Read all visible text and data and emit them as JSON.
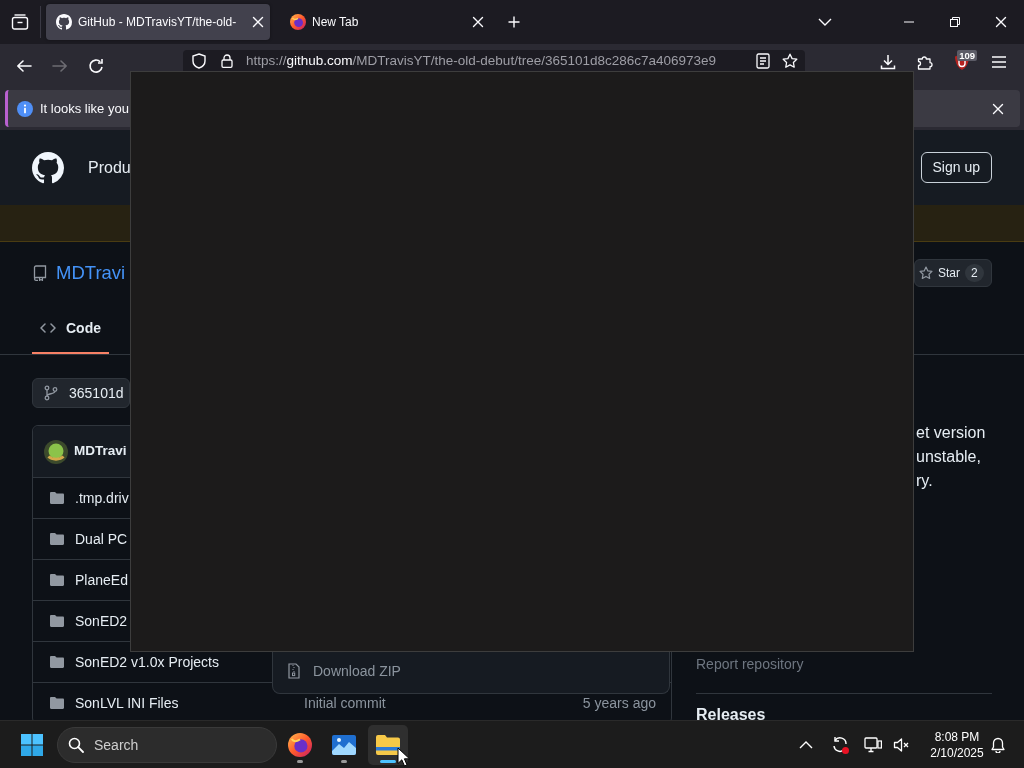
{
  "browser": {
    "tabs": [
      {
        "kind": "site",
        "title": "GitHub - MDTravisYT/the-old-",
        "selected": true
      },
      {
        "kind": "newtab",
        "title": "New Tab",
        "selected": false
      }
    ],
    "toolbar": {
      "back_disabled": false,
      "forward_disabled": true,
      "url_scheme": "https://",
      "url_host": "github.com",
      "url_path": "/MDTravisYT/the-old-debut/tree/365101d8c286c7a406973e9",
      "extension_badge": "109"
    },
    "notification": {
      "text": "It looks like you"
    }
  },
  "github": {
    "header": {
      "nav_item": "Produ",
      "sign_up": "Sign up"
    },
    "repo": {
      "owner": "MDTravi",
      "star_label": "Star",
      "star_count": "2"
    },
    "tabs": [
      {
        "label": "Code",
        "selected": true
      }
    ],
    "branch": "365101d",
    "commit_author": "MDTravi",
    "files": [
      {
        "name": ".tmp.driv"
      },
      {
        "name": "Dual PC"
      },
      {
        "name": "PlaneEd"
      },
      {
        "name": "SonED2"
      },
      {
        "name": "SonED2 v1.0x Projects"
      },
      {
        "name": "SonLVL INI Files",
        "message": "Initial commit",
        "age": "5 years ago"
      }
    ],
    "code_menu": [
      "Download ZIP"
    ],
    "about_lines": [
      "et version",
      "unstable,",
      "ry."
    ],
    "report_link": "Report repository",
    "releases_heading": "Releases"
  },
  "taskbar": {
    "search_placeholder": "Search",
    "apps": [
      {
        "kind": "browser",
        "selected": false
      },
      {
        "kind": "photos",
        "selected": false
      },
      {
        "kind": "folder",
        "selected": true
      }
    ],
    "time": "8:08 PM",
    "date": "2/10/2025"
  }
}
